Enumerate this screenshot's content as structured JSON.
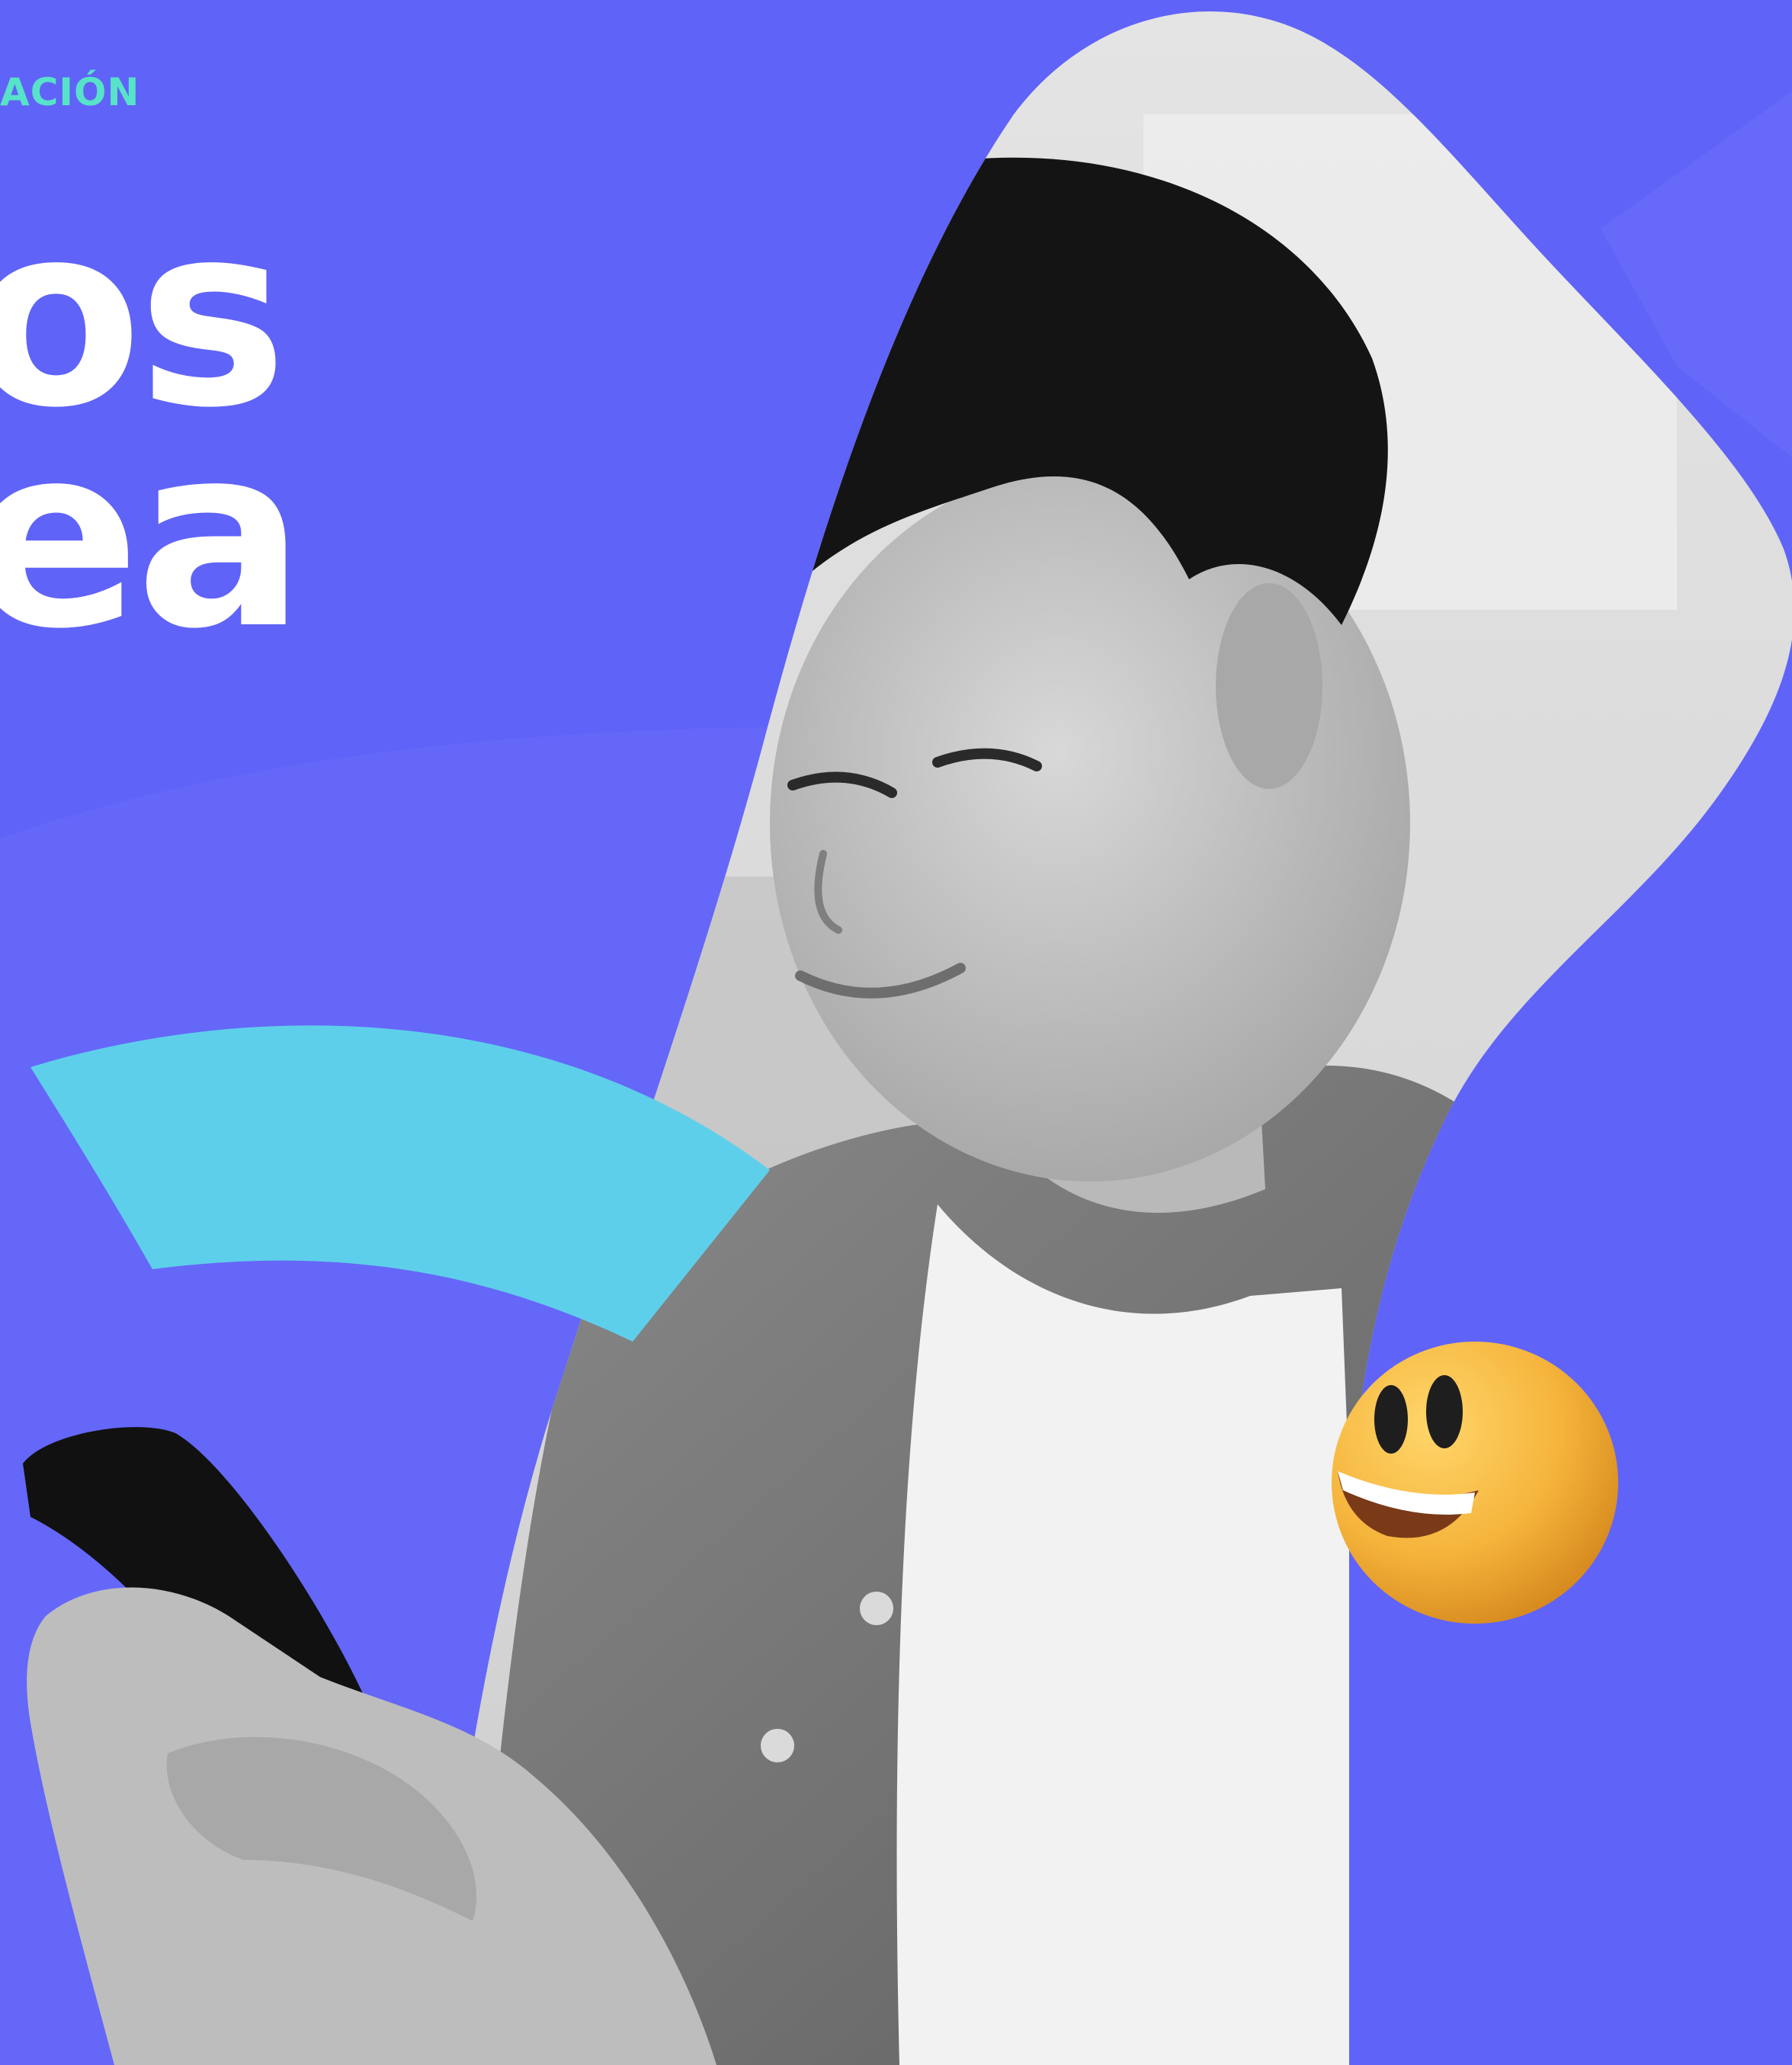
{
  "eyebrow": "ACIÓN",
  "headline": {
    "line1": "os",
    "line2": "ea"
  },
  "colors": {
    "background": "#6063F8",
    "accent_green": "#57E3C8",
    "accent_cyan": "#5ECFEA",
    "headline_text": "#FFFFFF",
    "emoji_face": "#F5B43C"
  },
  "icons": [
    "smiling-emoji-icon"
  ]
}
